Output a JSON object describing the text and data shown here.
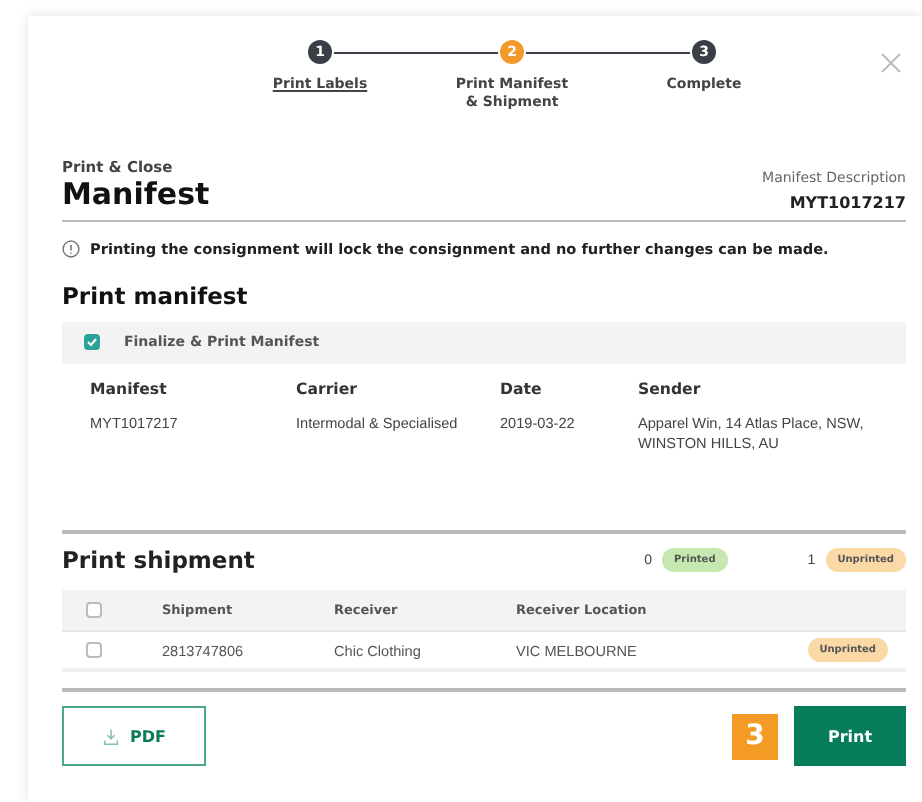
{
  "steps": [
    {
      "number": "1",
      "label": "Print Labels",
      "completed": true,
      "selected": false
    },
    {
      "number": "2",
      "label": "Print Manifest & Shipment",
      "completed": false,
      "selected": true
    },
    {
      "number": "3",
      "label": "Complete",
      "completed": false,
      "selected": false
    }
  ],
  "header": {
    "eyebrow": "Print & Close",
    "title": "Manifest",
    "description_label": "Manifest Description",
    "description_value": "MYT1017217"
  },
  "notice": "Printing the consignment will lock the consignment and no further changes can be made.",
  "manifest_section": {
    "title": "Print manifest",
    "finalize": {
      "label": "Finalize & Print Manifest",
      "checked": true
    },
    "columns": [
      "Manifest",
      "Carrier",
      "Date",
      "Sender"
    ],
    "rows": [
      [
        "MYT1017217",
        "Intermodal & Specialised",
        "2019-03-22",
        "Apparel Win, 14 Atlas Place, NSW, WINSTON HILLS, AU"
      ]
    ]
  },
  "shipment_section": {
    "title": "Print shipment",
    "printed_count": "0",
    "printed_label": "Printed",
    "unprinted_count": "1",
    "unprinted_label": "Unprinted",
    "select_all_checked": false,
    "columns": [
      "Shipment",
      "Receiver",
      "Receiver Location"
    ],
    "rows": [
      {
        "checked": false,
        "cells": [
          "2813747806",
          "Chic Clothing",
          "VIC MELBOURNE"
        ],
        "status": "Unprinted",
        "printed": false
      }
    ]
  },
  "footer": {
    "pdf_label": "PDF",
    "callout": "3",
    "print_label": "Print"
  }
}
